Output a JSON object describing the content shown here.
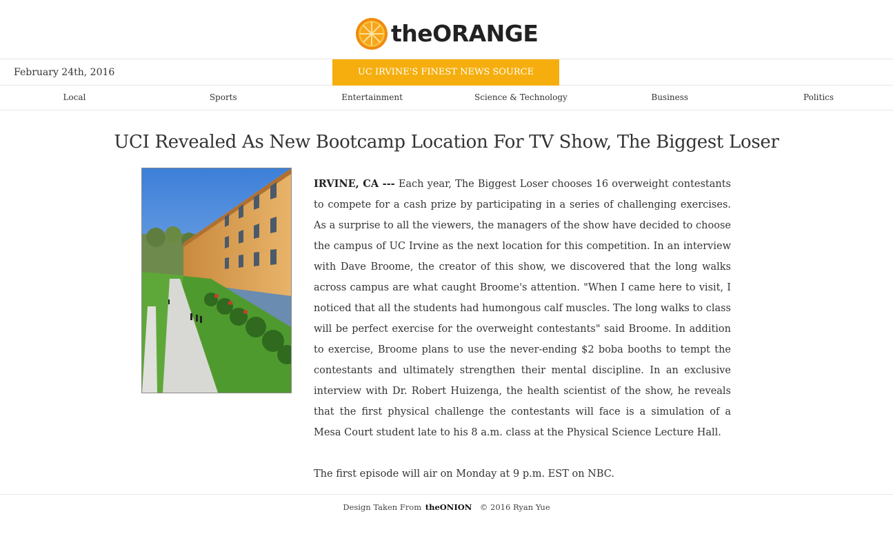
{
  "site": {
    "logo_text": "theORANGE",
    "logo_icon": "orange-slice-icon",
    "brand_color": "#f5ae0d"
  },
  "datebar": {
    "date": "February 24th, 2016",
    "tagline": "UC IRVINE'S FINEST NEWS SOURCE"
  },
  "nav": {
    "items": [
      "Local",
      "Sports",
      "Entertainment",
      "Science & Technology",
      "Business",
      "Politics"
    ]
  },
  "article": {
    "headline": "UCI Revealed As New Bootcamp Location For TV Show, The Biggest Loser",
    "dateline": "IRVINE, CA ---",
    "paragraph1": "Each year, The Biggest Loser chooses 16 overweight contestants to compete for a cash prize by participating in a series of challenging exercises. As a surprise to all the viewers, the managers of the show have decided to choose the campus of UC Irvine as the next location for this competition. In an interview with Dave Broome, the creator of this show, we discovered that the long walks across campus are what caught Broome's attention. \"When I came here to visit, I noticed that all the students had humongous calf muscles. The long walks to class will be perfect exercise for the overweight contestants\" said Broome. In addition to exercise, Broome plans to use the never-ending $2 boba booths to tempt the contestants and ultimately strengthen their mental discipline. In an exclusive interview with Dr. Robert Huizenga, the health scientist of the show, he reveals that the first physical challenge the contestants will face is a simulation of a Mesa Court student late to his 8 a.m. class at the Physical Science Lecture Hall.",
    "paragraph2": "The first episode will air on Monday at 9 p.m. EST on NBC."
  },
  "footer": {
    "design_text": "Design Taken From",
    "design_link": "theONION",
    "copyright": "© 2016 Ryan Yue"
  }
}
